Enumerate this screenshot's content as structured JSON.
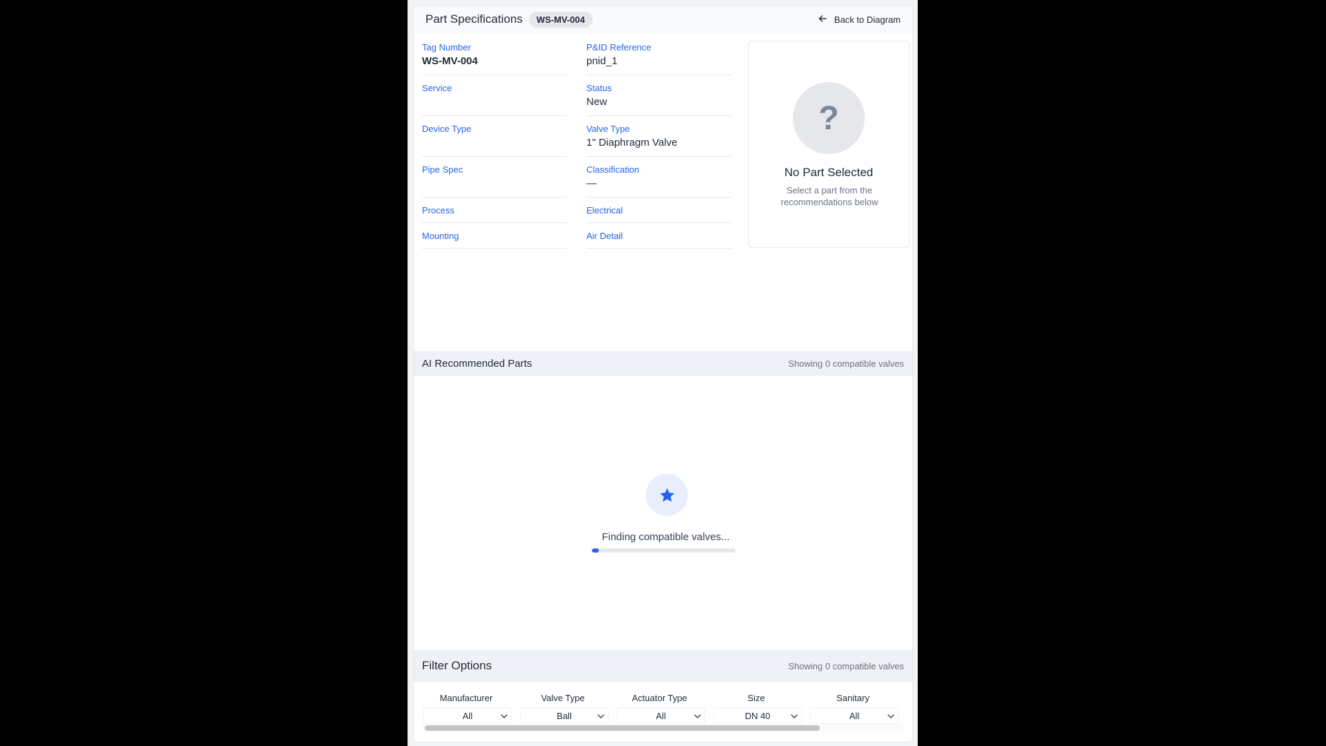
{
  "header": {
    "title": "Part Specifications",
    "tag_badge": "WS-MV-004",
    "back_label": "Back to Diagram"
  },
  "specs": {
    "tag_number": {
      "label": "Tag Number",
      "value": "WS-MV-004"
    },
    "pid_reference": {
      "label": "P&ID Reference",
      "value": "pnid_1"
    },
    "service": {
      "label": "Service",
      "value": ""
    },
    "status": {
      "label": "Status",
      "value": "New"
    },
    "device_type": {
      "label": "Device Type",
      "value": ""
    },
    "valve_type": {
      "label": "Valve Type",
      "value": "1\" Diaphragm Valve"
    },
    "pipe_spec": {
      "label": "Pipe Spec",
      "value": ""
    },
    "classification": {
      "label": "Classification",
      "value": "—"
    },
    "process": {
      "label": "Process"
    },
    "electrical": {
      "label": "Electrical"
    },
    "mounting": {
      "label": "Mounting"
    },
    "air_detail": {
      "label": "Air Detail"
    }
  },
  "no_part": {
    "icon": "question-icon",
    "glyph": "?",
    "title": "No Part Selected",
    "subtitle": "Select a part from the recommendations below"
  },
  "recommended": {
    "title": "AI Recommended Parts",
    "count_text": "Showing 0 compatible valves",
    "loading_text": "Finding compatible valves...",
    "loading_icon": "star-icon",
    "progress": 0.05
  },
  "filters": {
    "title": "Filter Options",
    "count_text": "Showing 0 compatible valves",
    "items": [
      {
        "label": "Manufacturer",
        "value": "All"
      },
      {
        "label": "Valve Type",
        "value": "Ball"
      },
      {
        "label": "Actuator Type",
        "value": "All"
      },
      {
        "label": "Size",
        "value": "DN 40"
      },
      {
        "label": "Sanitary",
        "value": "All"
      }
    ]
  },
  "colors": {
    "accent": "#2563eb",
    "label_blue": "#2563eb",
    "text_dark": "#1f2937",
    "text_muted": "#6b7280"
  }
}
